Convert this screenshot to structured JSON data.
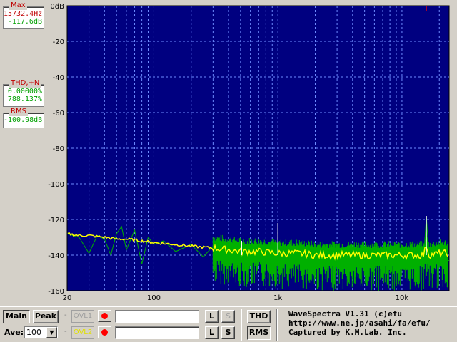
{
  "meters": {
    "max": {
      "caption": "Max",
      "freq": "15732.4Hz",
      "level": "-117.6dB"
    },
    "thd": {
      "caption": "THD,+N",
      "value1": "0.00000%",
      "value2": "788.137%"
    },
    "rms": {
      "caption": "RMS",
      "value": "-100.98dB"
    }
  },
  "colors": {
    "plot_bg": "#000080",
    "grid": "#6e8cff",
    "green": "#00b000",
    "yellow": "#ffff00",
    "white": "#ffffff"
  },
  "chart_data": {
    "type": "line",
    "x_scale": "log",
    "xlim": [
      20,
      24000
    ],
    "ylim": [
      -160,
      0
    ],
    "y_ticks": [
      0,
      -20,
      -40,
      -60,
      -80,
      -100,
      -120,
      -140,
      -160
    ],
    "y_tick_labels": [
      "0dB",
      "-20",
      "-40",
      "-60",
      "-80",
      "-100",
      "-120",
      "-140",
      "-160"
    ],
    "x_ticks": [
      20,
      100,
      1000,
      10000
    ],
    "x_tick_labels": [
      "20",
      "100",
      "1k",
      "10k"
    ],
    "grid": true,
    "series": [
      {
        "color": "#00b000",
        "x": [
          20,
          25,
          30,
          35,
          40,
          45,
          50,
          55,
          60,
          70,
          80,
          90,
          100,
          120,
          150,
          200,
          250,
          300,
          400,
          500,
          600,
          800,
          1000,
          1200,
          1500,
          2000,
          3000,
          4000,
          5000,
          6000,
          8000,
          10000,
          12000,
          15000,
          15732,
          16500,
          20000,
          24000
        ],
        "y": [
          -128,
          -130,
          -139,
          -129,
          -131,
          -140,
          -128,
          -124,
          -137,
          -126,
          -145,
          -130,
          -134,
          -132,
          -138,
          -134,
          -141,
          -135,
          -142,
          -138,
          -144,
          -141,
          -140,
          -142,
          -143,
          -140,
          -145,
          -142,
          -144,
          -143,
          -145,
          -143,
          -145,
          -142,
          -118,
          -140,
          -144,
          -143
        ]
      },
      {
        "color": "#ffff00",
        "x": [
          20,
          25,
          30,
          40,
          50,
          60,
          80,
          100,
          150,
          200,
          300,
          400,
          500,
          600,
          700,
          1000,
          1500,
          2000,
          3000,
          5000,
          8000,
          10000,
          15000,
          15732,
          16500,
          20000,
          24000
        ],
        "y": [
          -128,
          -129,
          -129,
          -130,
          -131,
          -131,
          -132,
          -133,
          -134,
          -135,
          -136,
          -137,
          -138,
          -138,
          -138,
          -139,
          -139,
          -140,
          -140,
          -140,
          -140,
          -140,
          -140,
          -134,
          -140,
          -139,
          -139
        ]
      }
    ],
    "peaks": [
      {
        "x": 510,
        "y": -132
      },
      {
        "x": 1000,
        "y": -122
      },
      {
        "x": 15732,
        "y": -118
      }
    ]
  },
  "controls": {
    "main_label": "Main",
    "peak_label": "Peak",
    "ave_label": "Ave:",
    "ave_value": "100",
    "dash": "-",
    "ovl1_label": "OVL1",
    "ovl2_label": "OVL2",
    "l_label": "L",
    "s_label": "S",
    "thd_label": "THD",
    "rms_label": "RMS"
  },
  "info": {
    "line1": "WaveSpectra V1.31 (c)efu",
    "line2": "http://www.ne.jp/asahi/fa/efu/",
    "line3": "Captured by K.M.Lab. Inc."
  }
}
